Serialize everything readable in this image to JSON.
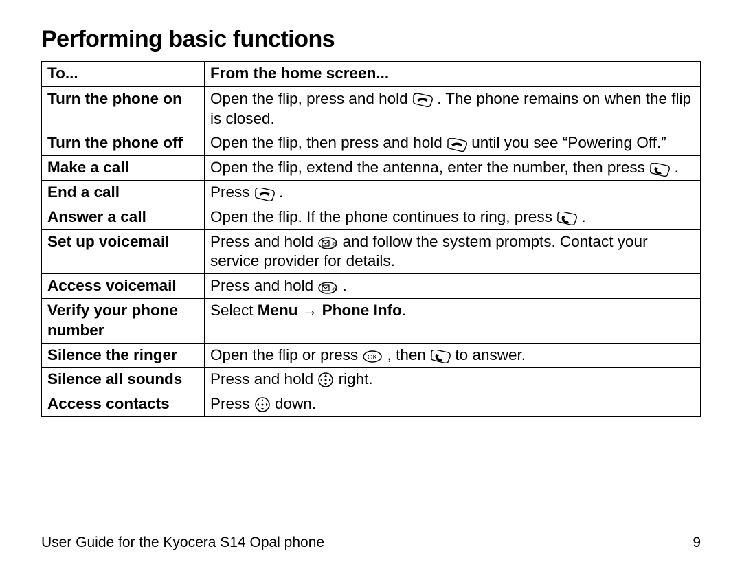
{
  "title": "Performing basic functions",
  "header": {
    "col1": "To...",
    "col2": "From the home screen..."
  },
  "rows": [
    {
      "task": "Turn the phone on",
      "parts": [
        {
          "t": "Open the flip, press and hold "
        },
        {
          "i": "end"
        },
        {
          "t": " . The phone remains on when the flip is closed."
        }
      ]
    },
    {
      "task": "Turn the phone off",
      "parts": [
        {
          "t": "Open the flip, then press and hold "
        },
        {
          "i": "end"
        },
        {
          "t": "  until you see “Powering Off.”"
        }
      ]
    },
    {
      "task": "Make a call",
      "parts": [
        {
          "t": "Open the flip, extend the antenna, enter the number, then press "
        },
        {
          "i": "send"
        },
        {
          "t": " ."
        }
      ]
    },
    {
      "task": "End a call",
      "parts": [
        {
          "t": "Press "
        },
        {
          "i": "end"
        },
        {
          "t": " ."
        }
      ]
    },
    {
      "task": "Answer a call",
      "parts": [
        {
          "t": "Open the flip. If the phone continues to ring, press "
        },
        {
          "i": "send"
        },
        {
          "t": " ."
        }
      ]
    },
    {
      "task": "Set up voicemail",
      "parts": [
        {
          "t": "Press and hold "
        },
        {
          "i": "vm"
        },
        {
          "t": " and follow the system prompts. Contact your service provider for details."
        }
      ]
    },
    {
      "task": "Access voicemail",
      "parts": [
        {
          "t": "Press and hold "
        },
        {
          "i": "vm"
        },
        {
          "t": " ."
        }
      ]
    },
    {
      "task": "Verify your phone number",
      "parts": [
        {
          "t": "Select "
        },
        {
          "b": "Menu"
        },
        {
          "t": " → "
        },
        {
          "b": "Phone Info"
        },
        {
          "t": "."
        }
      ]
    },
    {
      "task": "Silence the ringer",
      "parts": [
        {
          "t": "Open the flip or press "
        },
        {
          "i": "ok"
        },
        {
          "t": " , then "
        },
        {
          "i": "send"
        },
        {
          "t": "  to answer."
        }
      ]
    },
    {
      "task": "Silence all sounds",
      "parts": [
        {
          "t": "Press and hold "
        },
        {
          "i": "nav"
        },
        {
          "t": "  right."
        }
      ]
    },
    {
      "task": "Access contacts",
      "parts": [
        {
          "t": "Press "
        },
        {
          "i": "nav"
        },
        {
          "t": "  down."
        }
      ]
    }
  ],
  "footer": {
    "left": "User Guide for the Kyocera S14 Opal phone",
    "right": "9"
  }
}
